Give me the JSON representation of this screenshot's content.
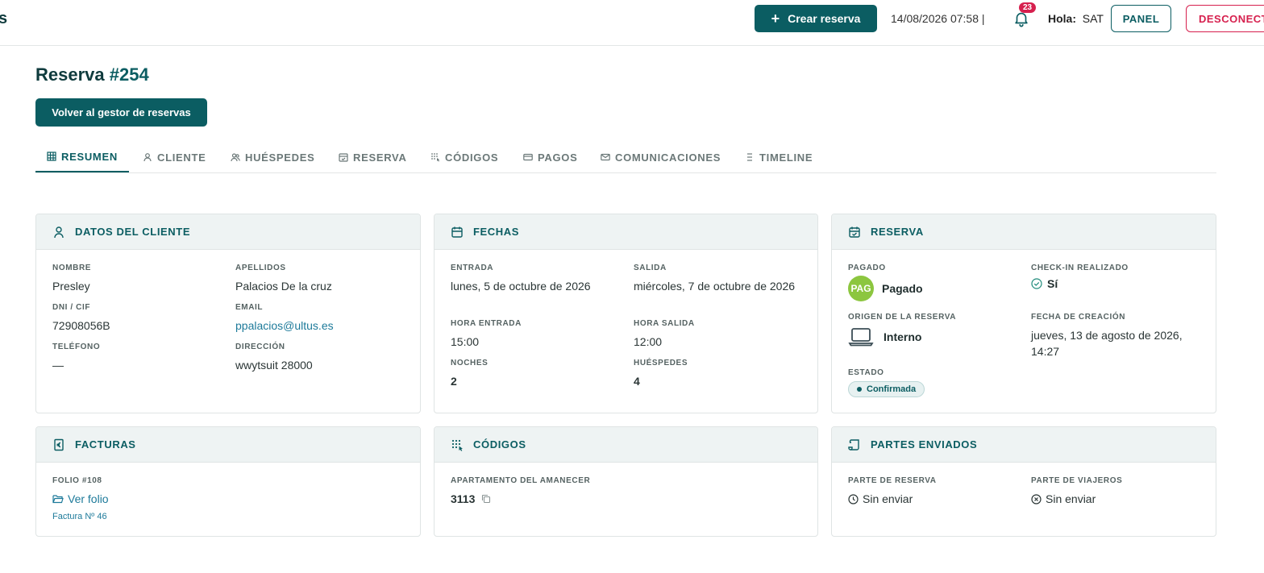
{
  "topbar": {
    "brand_tail": "s",
    "create_label": "Crear reserva",
    "datetime": "14/08/2026 07:58 |",
    "notifications_count": "23",
    "greeting_label": "Hola:",
    "greeting_user": "SAT",
    "panel_label": "PANEL",
    "logout_label": "DESCONECTAR"
  },
  "page": {
    "title_prefix": "Reserva",
    "title_number": "#254",
    "back_label": "Volver al gestor de reservas"
  },
  "tabs": [
    {
      "label": "RESUMEN",
      "icon": "grid-icon"
    },
    {
      "label": "CLIENTE",
      "icon": "user-icon"
    },
    {
      "label": "HUÉSPEDES",
      "icon": "users-icon"
    },
    {
      "label": "RESERVA",
      "icon": "calendar-check-icon"
    },
    {
      "label": "CÓDIGOS",
      "icon": "keypad-icon"
    },
    {
      "label": "PAGOS",
      "icon": "credit-card-icon"
    },
    {
      "label": "COMUNICACIONES",
      "icon": "mail-icon"
    },
    {
      "label": "TIMELINE",
      "icon": "list-icon"
    }
  ],
  "cliente": {
    "title": "DATOS DEL CLIENTE",
    "nombre_label": "NOMBRE",
    "nombre": "Presley",
    "apellidos_label": "APELLIDOS",
    "apellidos": "Palacios De la cruz",
    "dni_label": "DNI / CIF",
    "dni": "72908056B",
    "email_label": "EMAIL",
    "email": "ppalacios@ultus.es",
    "telefono_label": "TELÉFONO",
    "telefono": "—",
    "direccion_label": "DIRECCIÓN",
    "direccion": "wwytsuit 28000"
  },
  "fechas": {
    "title": "FECHAS",
    "entrada_label": "ENTRADA",
    "entrada": "lunes, 5 de octubre de 2026",
    "salida_label": "SALIDA",
    "salida": "miércoles, 7 de octubre de 2026",
    "hora_entrada_label": "HORA ENTRADA",
    "hora_entrada": "15:00",
    "hora_salida_label": "HORA SALIDA",
    "hora_salida": "12:00",
    "noches_label": "NOCHES",
    "noches": "2",
    "huespedes_label": "HUÉSPEDES",
    "huespedes": "4"
  },
  "reserva": {
    "title": "RESERVA",
    "pagado_label": "PAGADO",
    "pagado_badge": "PAG",
    "pagado": "Pagado",
    "checkin_label": "CHECK-IN REALIZADO",
    "checkin": "Sí",
    "origen_label": "ORIGEN DE LA RESERVA",
    "origen": "Interno",
    "creacion_label": "FECHA DE CREACIÓN",
    "creacion": "jueves, 13 de agosto de 2026, 14:27",
    "estado_label": "ESTADO",
    "estado": "Confirmada"
  },
  "facturas": {
    "title": "FACTURAS",
    "folio_label": "FOLIO #108",
    "ver_folio": "Ver folio",
    "factura": "Factura Nº 46"
  },
  "codigos": {
    "title": "CÓDIGOS",
    "apartamento_label": "APARTAMENTO DEL AMANECER",
    "codigo": "3113"
  },
  "partes": {
    "title": "PARTES ENVIADOS",
    "reserva_label": "PARTE DE RESERVA",
    "reserva": "Sin enviar",
    "viajeros_label": "PARTE DE VIAJEROS",
    "viajeros": "Sin enviar"
  }
}
